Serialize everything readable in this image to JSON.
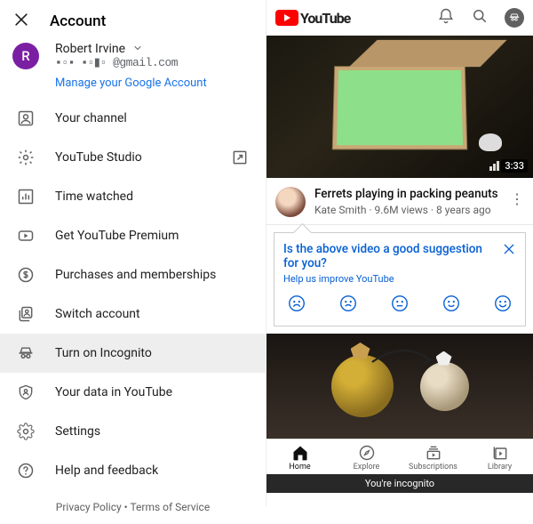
{
  "account": {
    "title": "Account",
    "avatar_initial": "R",
    "display_name": "Robert Irvine",
    "email_masked": "▪▫▪ ▪▫▮▫ @gmail.com",
    "manage_link": "Manage your Google Account",
    "menu": {
      "your_channel": "Your channel",
      "youtube_studio": "YouTube Studio",
      "time_watched": "Time watched",
      "premium": "Get YouTube Premium",
      "purchases": "Purchases and memberships",
      "switch_account": "Switch account",
      "incognito": "Turn on Incognito",
      "your_data": "Your data in YouTube",
      "settings": "Settings",
      "help": "Help and feedback"
    },
    "footer": {
      "privacy": "Privacy Policy",
      "dot": " • ",
      "terms": "Terms of Service"
    }
  },
  "youtube": {
    "brand": "YouTube",
    "video1": {
      "duration": "3:33",
      "title": "Ferrets playing in packing peanuts",
      "channel": "Kate Smith",
      "meta": " · 9.6M views · 8 years ago"
    },
    "feedback": {
      "question": "Is the above video a good suggestion for you?",
      "help": "Help us improve YouTube"
    },
    "nav": {
      "home": "Home",
      "explore": "Explore",
      "subs": "Subscriptions",
      "library": "Library"
    },
    "incognito_bar": "You're incognito"
  }
}
